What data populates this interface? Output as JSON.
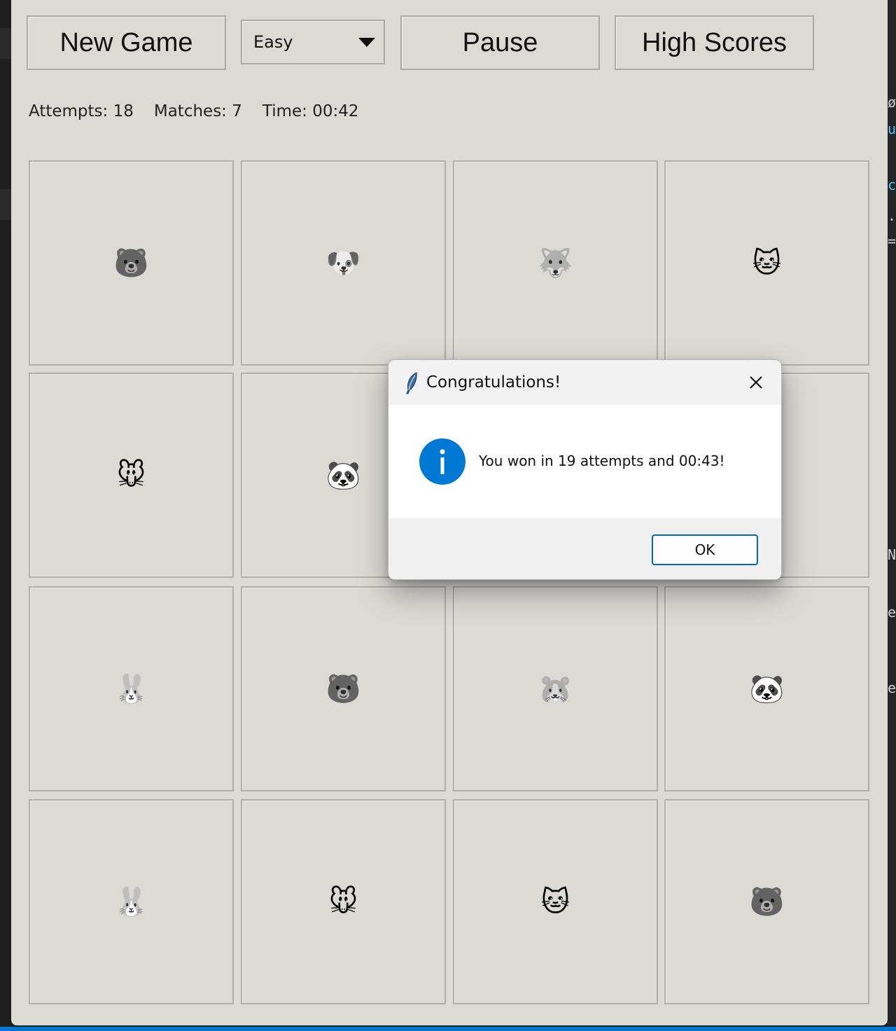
{
  "toolbar": {
    "new_game_label": "New Game",
    "difficulty_selected": "Easy",
    "pause_label": "Pause",
    "high_scores_label": "High Scores"
  },
  "stats": {
    "attempts": "Attempts: 18",
    "matches": "Matches: 7",
    "time": "Time: 00:42"
  },
  "board": {
    "cards": [
      {
        "glyph": "🐻",
        "icon": "hamster-face-icon"
      },
      {
        "glyph": "🐶",
        "icon": "dog-face-icon"
      },
      {
        "glyph": "🐺",
        "icon": "wolf-face-icon"
      },
      {
        "glyph": "🐱",
        "icon": "cat-face-icon"
      },
      {
        "glyph": "🐭",
        "icon": "mouse-face-icon"
      },
      {
        "glyph": "🐼",
        "icon": "panda-face-icon"
      },
      {
        "glyph": "",
        "icon": "hidden-card"
      },
      {
        "glyph": "",
        "icon": "hidden-card"
      },
      {
        "glyph": "🐰",
        "icon": "rabbit-face-icon"
      },
      {
        "glyph": "🐻",
        "icon": "bear-face-icon"
      },
      {
        "glyph": "🐹",
        "icon": "hamster-face-icon"
      },
      {
        "glyph": "🐼",
        "icon": "panda-face-icon"
      },
      {
        "glyph": "🐰",
        "icon": "rabbit-face-icon"
      },
      {
        "glyph": "🐭",
        "icon": "mouse-face-icon"
      },
      {
        "glyph": "🐱",
        "icon": "cat-face-icon"
      },
      {
        "glyph": "🐻",
        "icon": "bear-face-icon"
      }
    ]
  },
  "dialog": {
    "title": "Congratulations!",
    "message": "You won in 19 attempts and 00:43!",
    "ok_label": "OK",
    "icon": "info-icon",
    "accent": "#0078d4"
  },
  "background": {
    "right_fragments": [
      "ø",
      "u",
      "c",
      ".",
      "=",
      "N",
      "e",
      "e"
    ]
  }
}
